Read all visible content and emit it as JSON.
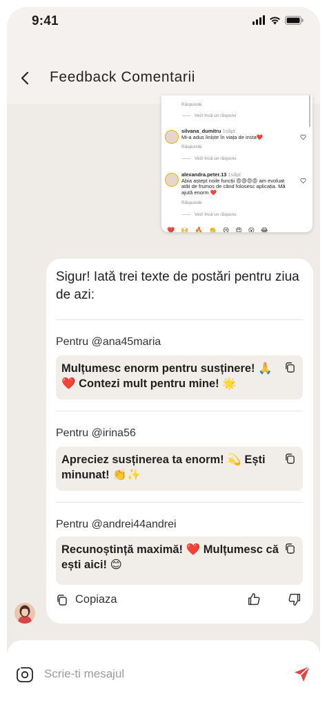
{
  "status": {
    "time": "9:41"
  },
  "header": {
    "title": "Feedback Comentarii"
  },
  "screenshot": {
    "top_reply": "Răspunde",
    "top_more": "Vezi încă un răspuns",
    "comments": [
      {
        "user": "silvana_dumitru",
        "ago": "1săpt",
        "text": "Mi-a adus liniște în viața de insta❤️",
        "reply": "Răspunde",
        "more": "Vezi încă un răspuns"
      },
      {
        "user": "alexandra.peter.13",
        "ago": "1săpt",
        "text": "Abia aștept noile funcții 😍😍😍😍 am evoluat atât de frumos de când folosesc aplicația. Mă ajută enorm ❤️",
        "reply": "Răspunde",
        "more": "Vezi încă un răspuns"
      }
    ],
    "bottom_emojis": [
      "❤️",
      "🙌",
      "🔥",
      "👏",
      "😢",
      "😍",
      "😮",
      "😂"
    ]
  },
  "response": {
    "intro": "Sigur! Iată trei texte de postări pentru ziua de azi:",
    "items": [
      {
        "label": "Pentru @ana45maria",
        "text": "Mulțumesc enorm pentru susținere! 🙏❤️ Contezi mult pentru mine! 🌟"
      },
      {
        "label": "Pentru @irina56",
        "text": "Apreciez susținerea ta enorm! 💫 Ești minunat! 👏✨"
      },
      {
        "label": "Pentru @andrei44andrei",
        "text": "Recunoștință maximă! ❤️ Mulțumesc că ești aici! 😊"
      }
    ],
    "copy_label": "Copiaza"
  },
  "composer": {
    "placeholder": "Scrie-ti mesajul"
  },
  "colors": {
    "accent": "#e8403c",
    "background": "#efebe7",
    "card": "#f1eeea"
  }
}
